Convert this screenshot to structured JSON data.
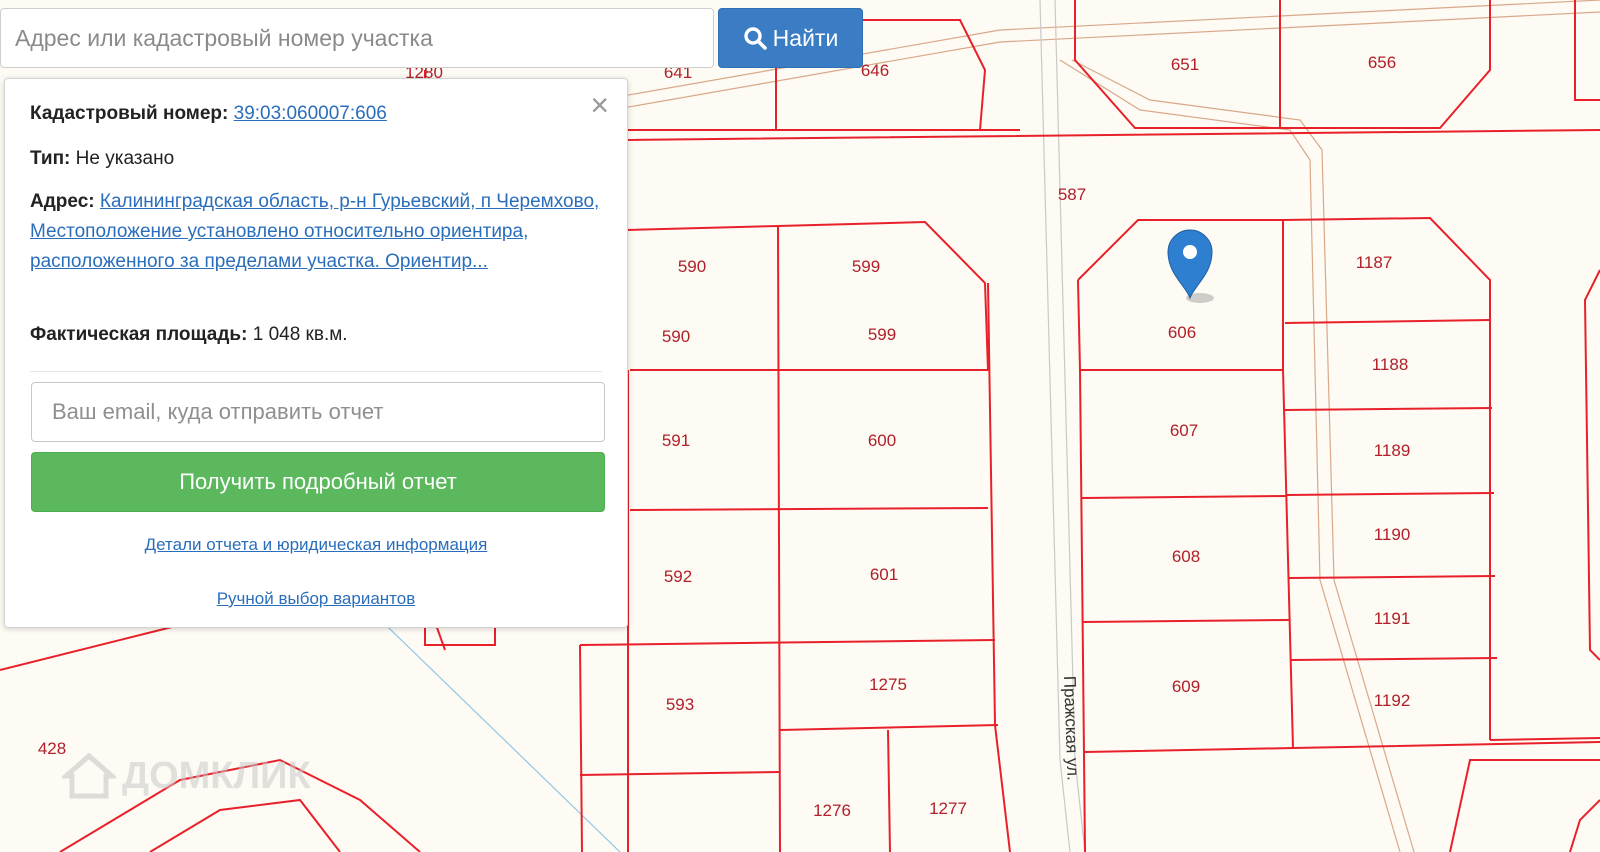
{
  "search": {
    "placeholder": "Адрес или кадастровый номер участка",
    "value": "",
    "button_label": "Найти"
  },
  "popup": {
    "close_symbol": "×",
    "cadastral_label": "Кадастровый номер:",
    "cadastral_number": "39:03:060007:606",
    "type_label": "Тип:",
    "type_value": "Не указано",
    "address_label": "Адрес:",
    "address_value": "Калининградская область, р-н Гурьевский, п Черемхово, Местоположение установлено относительно ориентира, расположенного за пределами участка. Ориентир...",
    "area_label": "Фактическая площадь:",
    "area_value": "1 048 кв.м.",
    "email_placeholder": "Ваш email, куда отправить отчет",
    "report_button": "Получить подробный отчет",
    "details_link": "Детали отчета и юридическая информация",
    "manual_link": "Ручной выбор вариантов"
  },
  "map": {
    "marker_icon": "map-pin-icon",
    "street_name": "Пражская ул.",
    "watermark": "ДОМКЛИК",
    "parcels": [
      "641",
      "646",
      "651",
      "656",
      "1280",
      "587",
      "590",
      "599",
      "606",
      "1187",
      "1188",
      "1189",
      "1190",
      "1191",
      "1192",
      "591",
      "600",
      "607",
      "592",
      "601",
      "608",
      "593",
      "1275",
      "609",
      "1276",
      "1277",
      "428"
    ],
    "colors": {
      "boundary": "#e8202a",
      "label": "#b0202a",
      "marker": "#2f7fd0"
    }
  }
}
